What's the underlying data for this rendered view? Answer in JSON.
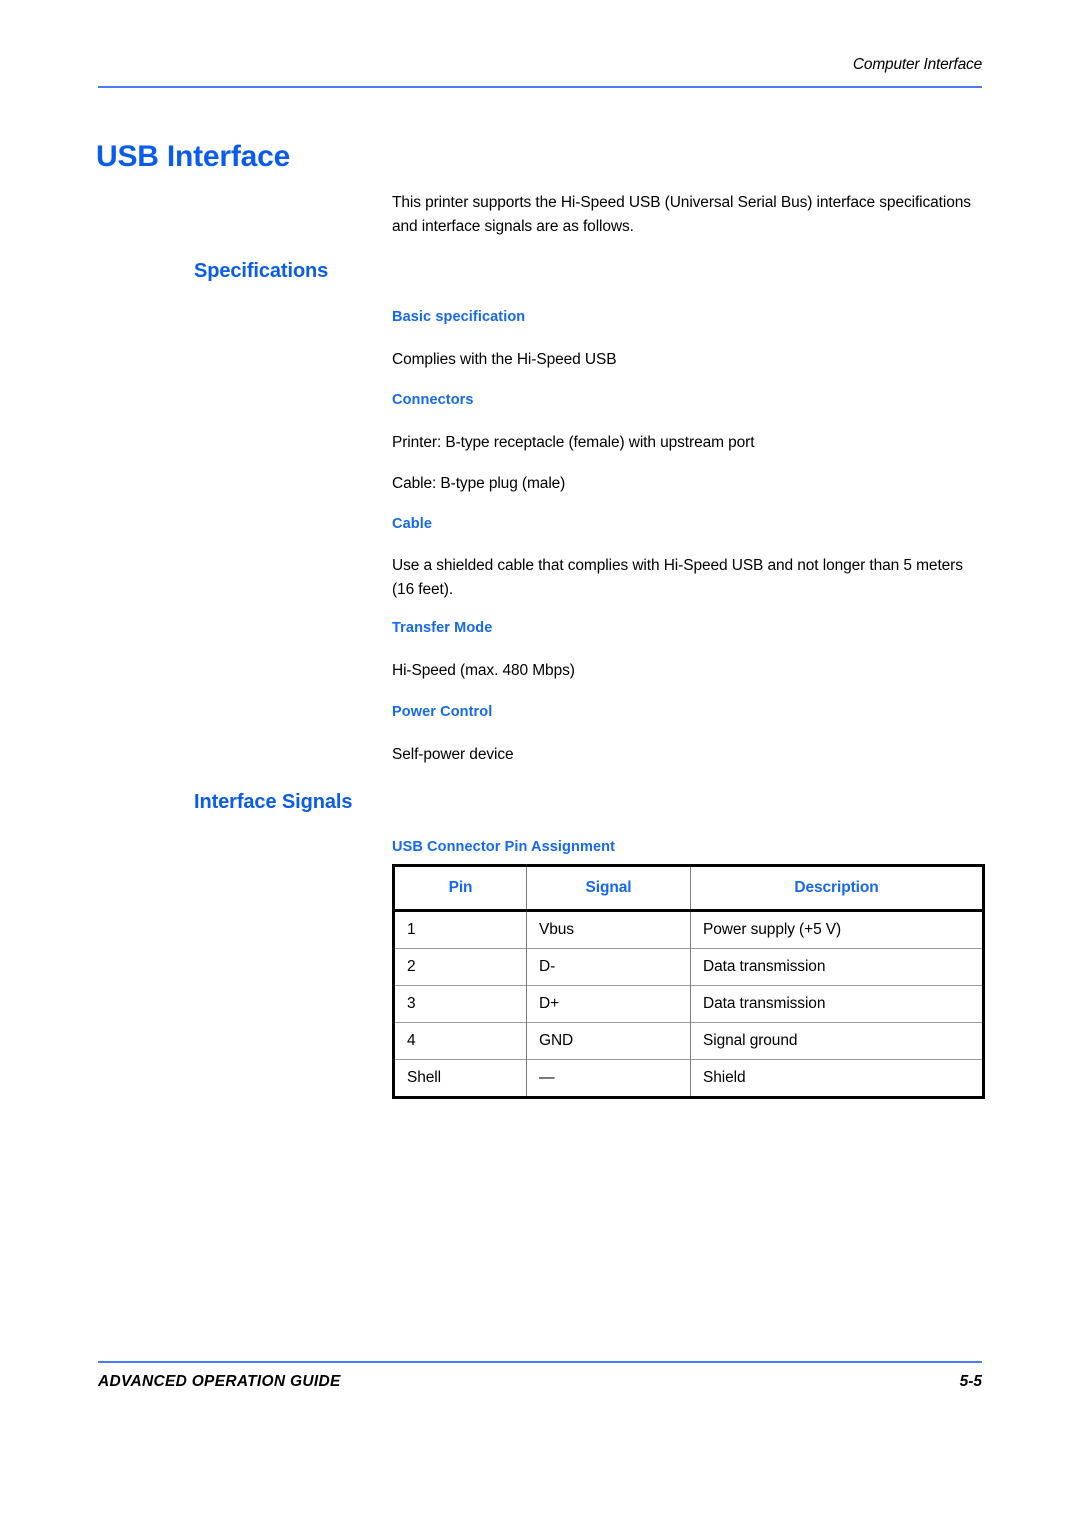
{
  "header": {
    "running_head": "Computer Interface",
    "rule_color": "#4a7bf7"
  },
  "title": {
    "chapter_title": "USB Interface",
    "color": "#0a5cf0"
  },
  "intro": {
    "paragraph": "This printer supports the Hi-Speed USB (Universal Serial Bus) interface specifications and interface signals are as follows."
  },
  "sections": {
    "specifications": {
      "heading": "Specifications",
      "basic_specification": {
        "heading": "Basic specification",
        "body": "Complies with the Hi-Speed USB"
      },
      "connectors": {
        "heading": "Connectors",
        "printer": "Printer: B-type receptacle (female) with upstream port",
        "cable": "Cable: B-type plug (male)"
      },
      "cable": {
        "heading": "Cable",
        "body": "Use a shielded cable that complies with Hi-Speed USB and not longer than 5 meters (16 feet)."
      },
      "transfer_mode": {
        "heading": "Transfer Mode",
        "body": "Hi-Speed (max. 480 Mbps)"
      },
      "power_control": {
        "heading": "Power Control",
        "body": "Self-power device"
      }
    },
    "interface_signals": {
      "heading": "Interface Signals",
      "pin_assignment": {
        "heading": "USB Connector Pin Assignment",
        "table": {
          "columns": [
            "Pin",
            "Signal",
            "Description"
          ],
          "rows": [
            [
              "1",
              "Vbus",
              "Power supply (+5 V)"
            ],
            [
              "2",
              "D-",
              "Data transmission"
            ],
            [
              "3",
              "D+",
              "Data transmission"
            ],
            [
              "4",
              "GND",
              "Signal ground"
            ],
            [
              "Shell",
              "—",
              "Shield"
            ]
          ]
        }
      }
    }
  },
  "footer": {
    "guide_name": "ADVANCED OPERATION GUIDE",
    "page_number": "5-5",
    "rule_color": "#4a7bf7"
  }
}
